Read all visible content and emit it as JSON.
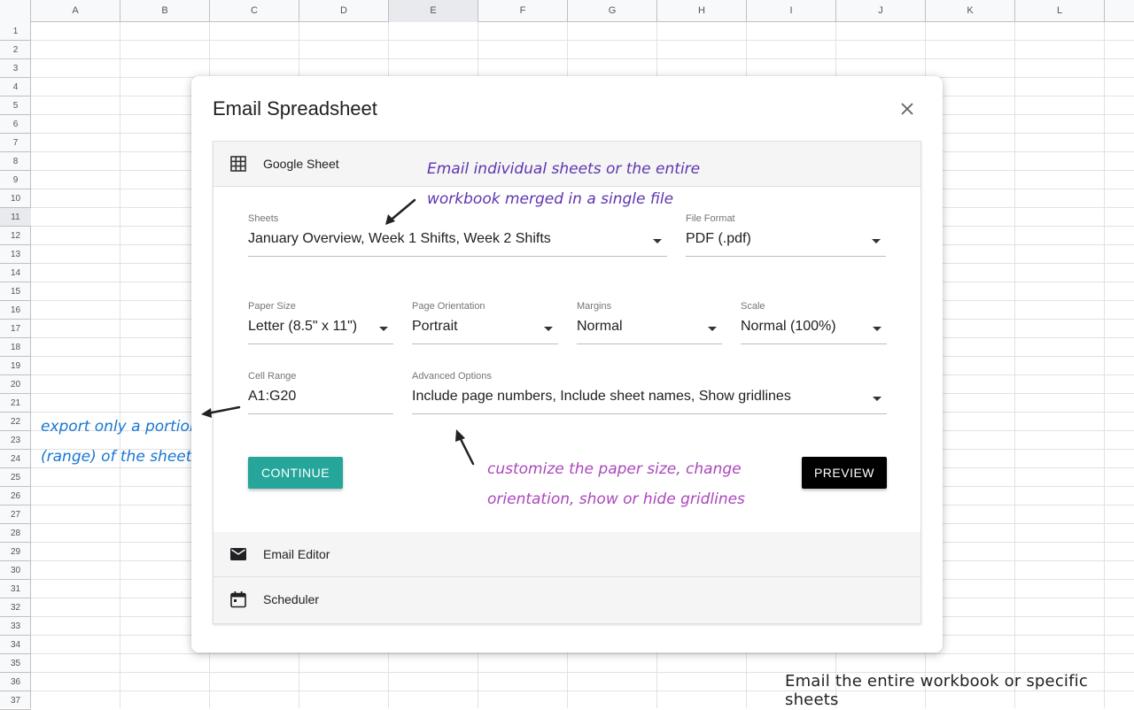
{
  "sheet": {
    "columns": [
      "A",
      "B",
      "C",
      "D",
      "E",
      "F",
      "G",
      "H",
      "I",
      "J",
      "K",
      "L"
    ],
    "rows": [
      "1",
      "2",
      "3",
      "4",
      "5",
      "6",
      "7",
      "8",
      "9",
      "10",
      "11",
      "12",
      "13",
      "14",
      "15",
      "16",
      "17",
      "18",
      "19",
      "20",
      "21",
      "22",
      "23",
      "24",
      "25",
      "26",
      "27",
      "28",
      "29",
      "30",
      "31",
      "32",
      "33",
      "34",
      "35",
      "36",
      "37"
    ],
    "selected_column": "E",
    "selected_row": "11"
  },
  "dialog": {
    "title": "Email Spreadsheet",
    "sections": {
      "google_sheet": "Google Sheet",
      "email_editor": "Email Editor",
      "scheduler": "Scheduler"
    },
    "fields": {
      "sheets": {
        "label": "Sheets",
        "value": "January Overview, Week 1 Shifts, Week 2 Shifts"
      },
      "file_format": {
        "label": "File Format",
        "value": "PDF (.pdf)"
      },
      "paper_size": {
        "label": "Paper Size",
        "value": "Letter (8.5\" x 11\")"
      },
      "page_orientation": {
        "label": "Page Orientation",
        "value": "Portrait"
      },
      "margins": {
        "label": "Margins",
        "value": "Normal"
      },
      "scale": {
        "label": "Scale",
        "value": "Normal (100%)"
      },
      "cell_range": {
        "label": "Cell Range",
        "value": "A1:G20"
      },
      "advanced_options": {
        "label": "Advanced Options",
        "value": "Include page numbers, Include sheet names, Show gridlines"
      }
    },
    "buttons": {
      "continue": "CONTINUE",
      "preview": "PREVIEW"
    }
  },
  "annotations": {
    "sheets_line1": "Email individual sheets or the entire",
    "sheets_line2": "workbook merged in a single file",
    "range_line1": "export only a portion",
    "range_line2": "(range) of the sheet",
    "custom_line1": "customize the paper size, change",
    "custom_line2": "orientation, show or hide gridlines"
  },
  "caption": "Email the entire workbook or specific sheets",
  "colors": {
    "continue": "#26a69a",
    "preview": "#000000",
    "anno_purple": "#5e35b1",
    "anno_blue": "#1976d2",
    "anno_magenta": "#ab47bc"
  }
}
